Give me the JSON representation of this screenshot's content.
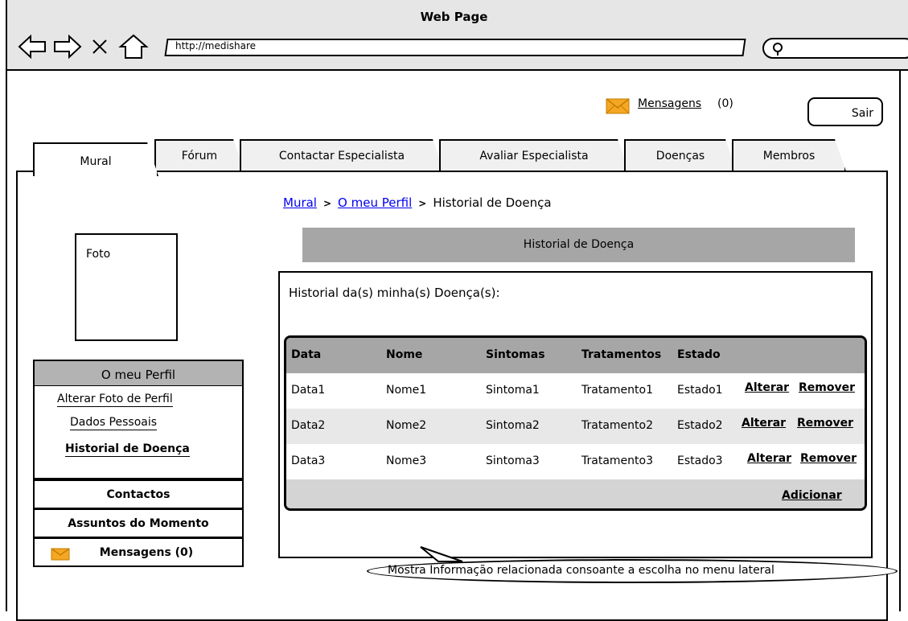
{
  "window": {
    "title": "Web Page"
  },
  "browser": {
    "url": "http://medishare"
  },
  "header": {
    "messages_link": "Mensagens",
    "messages_count": "(0)",
    "logout": "Sair"
  },
  "tabs": [
    {
      "label": "Mural"
    },
    {
      "label": "Fórum"
    },
    {
      "label": "Contactar Especialista"
    },
    {
      "label": "Avaliar Especialista"
    },
    {
      "label": "Doenças"
    },
    {
      "label": "Membros"
    }
  ],
  "breadcrumb": {
    "items": [
      "Mural",
      "O meu Perfil"
    ],
    "current": "Historial de Doença",
    "separator": ">"
  },
  "profile": {
    "photo_label": "Foto"
  },
  "sidebar": {
    "header": "O meu Perfil",
    "links": [
      "Alterar Foto de Perfil",
      "Dados Pessoais",
      "Historial de Doença"
    ],
    "contacts": "Contactos",
    "topics": "Assuntos do Momento",
    "messages": "Mensagens (0)"
  },
  "section": {
    "title": "Historial de Doença"
  },
  "content": {
    "heading": "Historial da(s) minha(s) Doença(s):"
  },
  "table": {
    "columns": [
      "Data",
      "Nome",
      "Sintomas",
      "Tratamentos",
      "Estado"
    ],
    "rows": [
      [
        "Data1",
        "Nome1",
        "Sintoma1",
        "Tratamento1",
        "Estado1"
      ],
      [
        "Data2",
        "Nome2",
        "Sintoma2",
        "Tratamento2",
        "Estado2"
      ],
      [
        "Data3",
        "Nome3",
        "Sintoma3",
        "Tratamento3",
        "Estado3"
      ]
    ],
    "edit_label": "Alterar",
    "remove_label": "Remover",
    "add_label": "Adicionar"
  },
  "callout": {
    "text": "Mostra Informação relacionada consoante a escolha no menu lateral"
  },
  "colors": {
    "link": "#0000ee",
    "bar": "#a6a6a6",
    "table_bg": "#d4d4d4",
    "row_alt": "#e8e8e8",
    "envelope": "#f5a623"
  }
}
